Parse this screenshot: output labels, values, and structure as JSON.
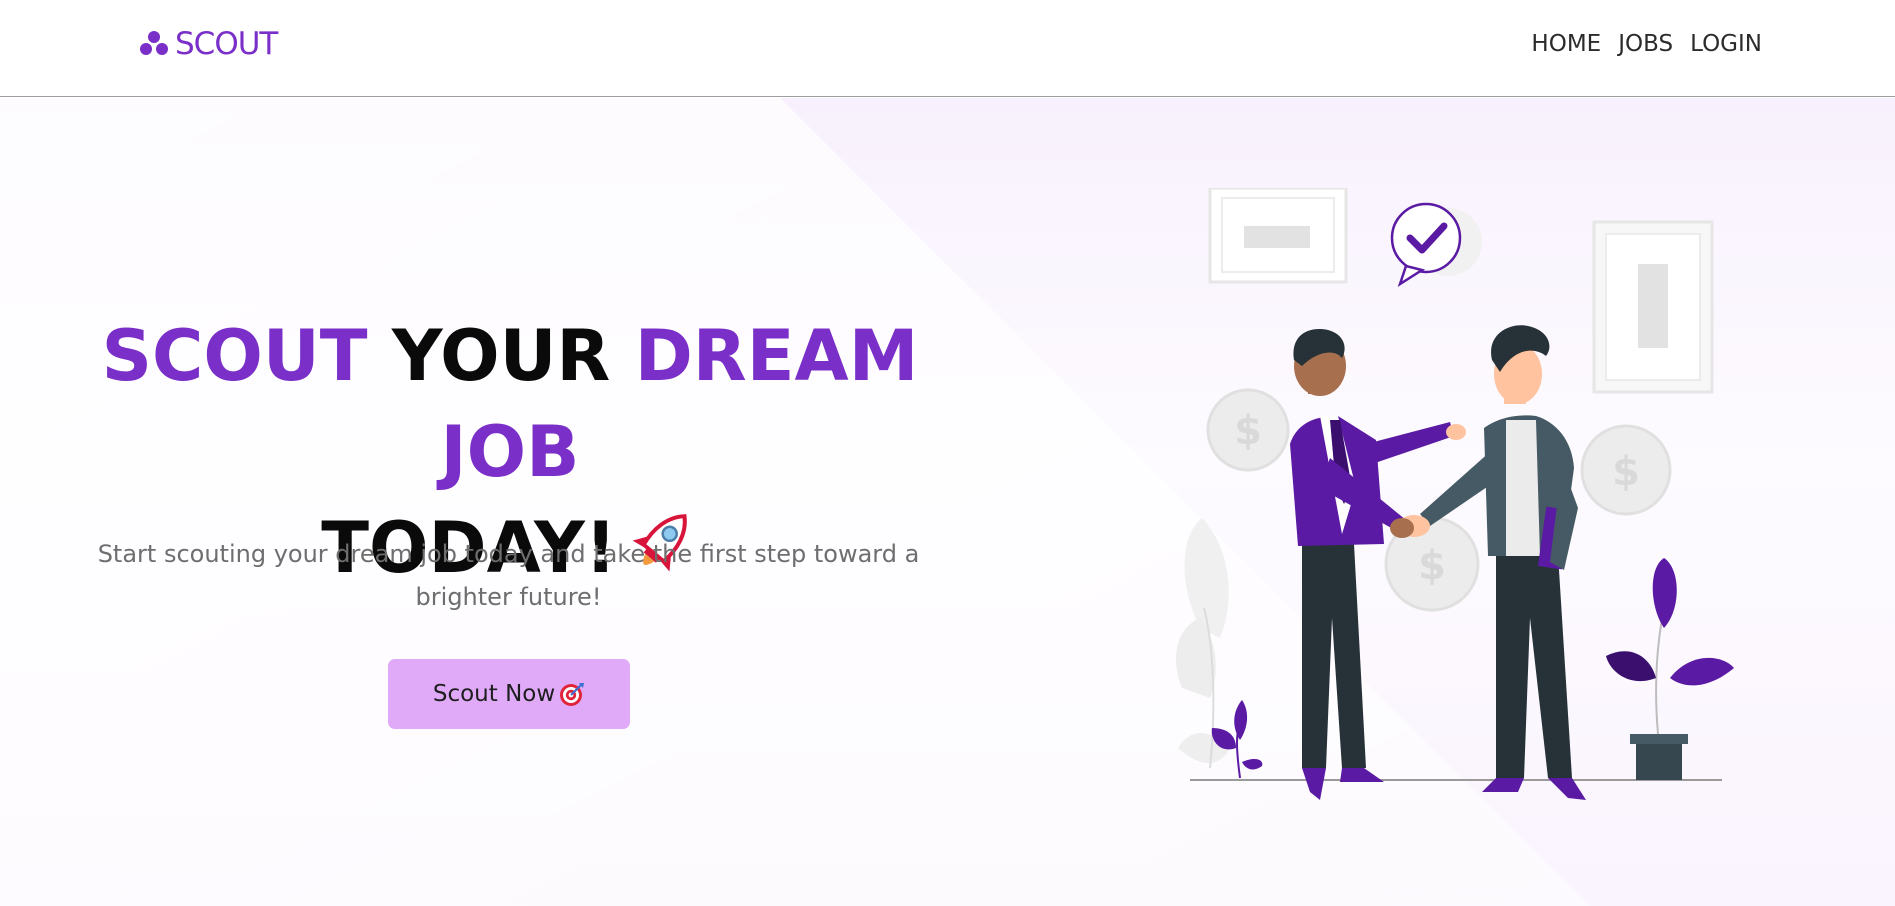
{
  "header": {
    "logo_text": "SCOUT",
    "nav": [
      {
        "label": "HOME"
      },
      {
        "label": "JOBS"
      },
      {
        "label": "LOGIN"
      }
    ]
  },
  "hero": {
    "headline": {
      "word1": "SCOUT",
      "word2": "YOUR",
      "word3": "DREAM JOB",
      "word4": "TODAY!"
    },
    "subtitle": "Start scouting your dream job today and take the first step toward a brighter future!",
    "cta_label": "Scout Now"
  },
  "icons": {
    "logo": "three-dots-logo-icon",
    "headline": "rocket-icon",
    "cta": "target-dart-icon",
    "illustration": "handshake-illustration"
  },
  "colors": {
    "brand_purple": "#7a2fc8",
    "cta_background": "#e0aaf9",
    "hero_background": "#f8f1fd",
    "illustration_purple": "#5a1aa3"
  }
}
